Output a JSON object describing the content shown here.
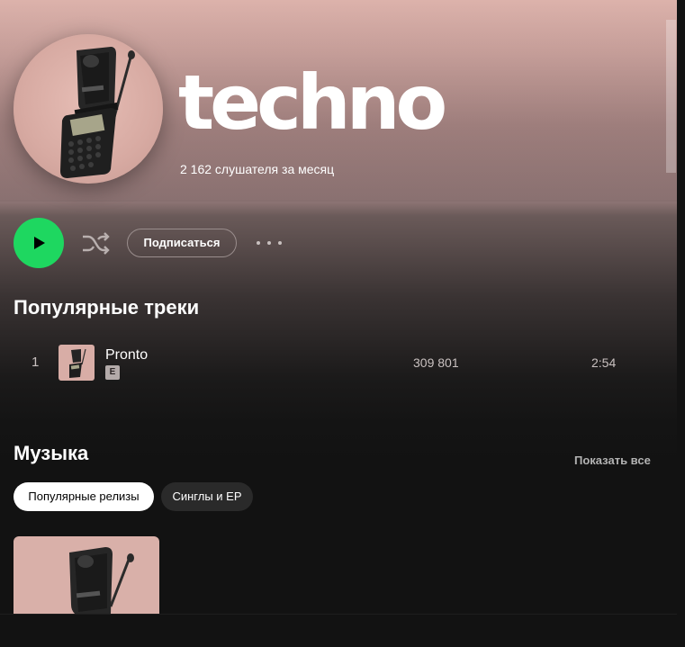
{
  "artist": {
    "name": "techno",
    "monthly_listeners": "2 162 слушателя за месяц"
  },
  "actions": {
    "follow_label": "Подписаться"
  },
  "popular": {
    "title": "Популярные треки",
    "tracks": [
      {
        "number": "1",
        "name": "Pronto",
        "explicit": "E",
        "plays": "309 801",
        "duration": "2:54"
      }
    ]
  },
  "music": {
    "title": "Музыка",
    "show_all": "Показать все",
    "filters": [
      {
        "label": "Популярные релизы",
        "active": true
      },
      {
        "label": "Синглы и EP",
        "active": false
      }
    ]
  },
  "colors": {
    "accent": "#1ed760",
    "hero_top": "#dcb2ab",
    "background": "#121212"
  },
  "icons": {
    "play": "play-icon",
    "shuffle": "shuffle-icon",
    "more": "more-icon"
  }
}
